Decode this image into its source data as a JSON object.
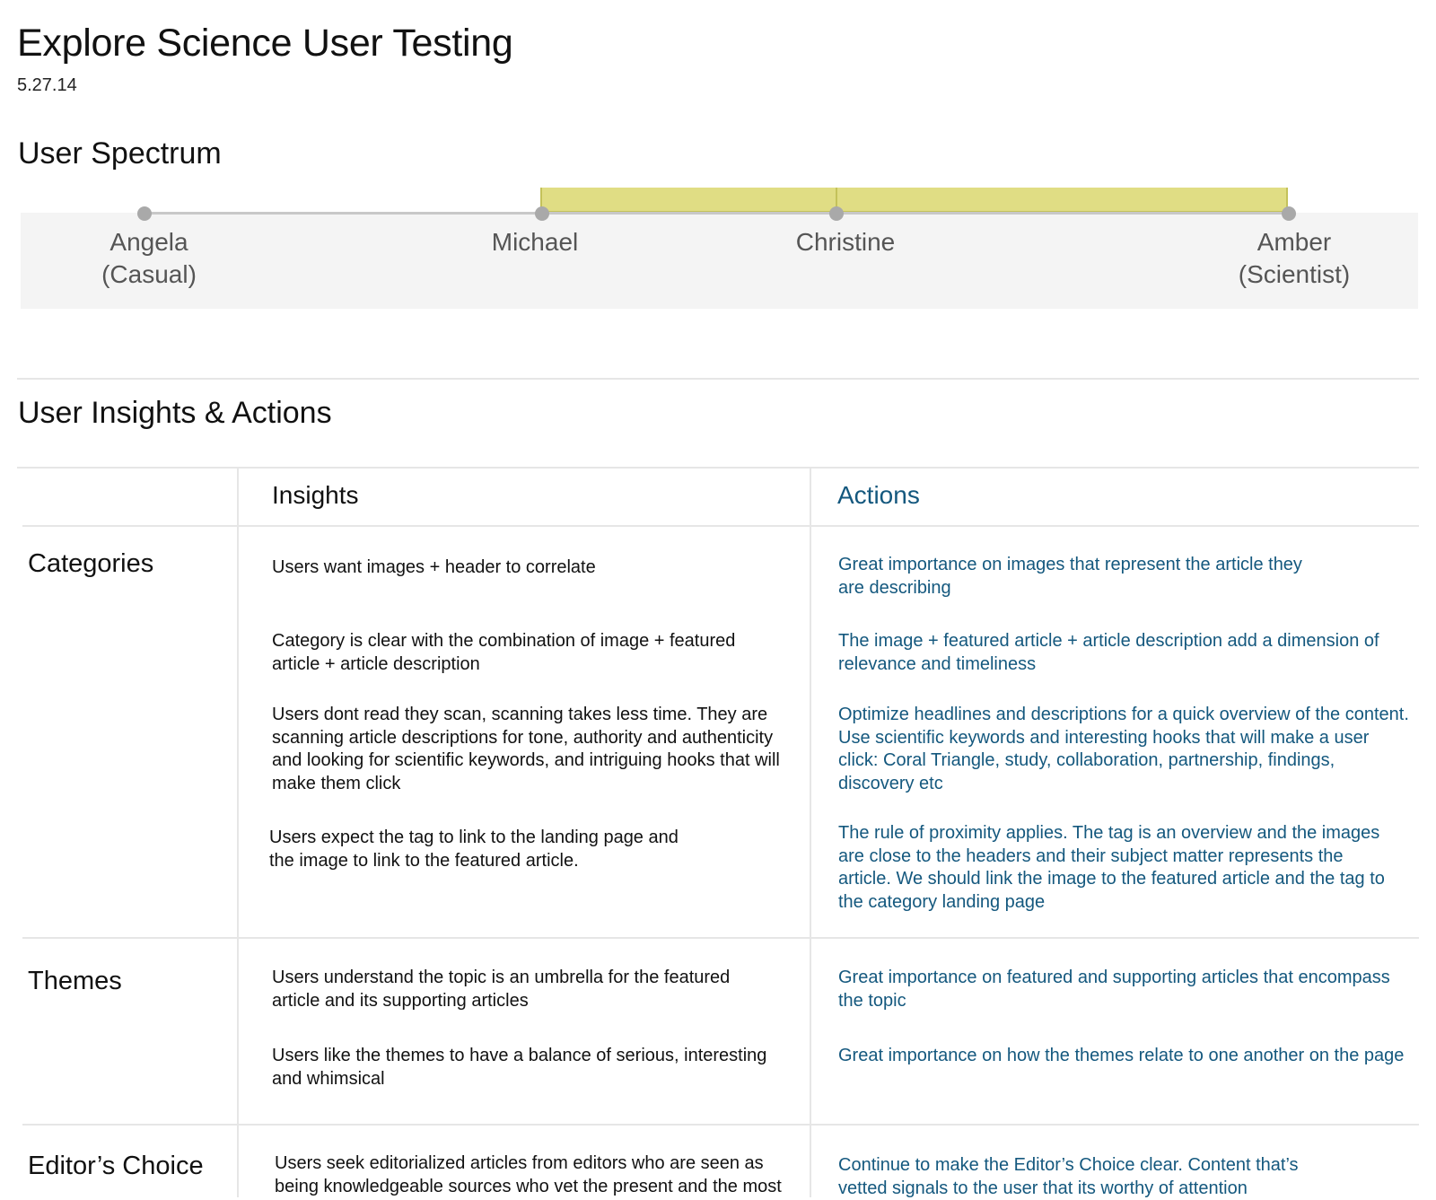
{
  "header": {
    "title": "Explore Science User Testing",
    "date": "5.27.14"
  },
  "spectrum": {
    "heading": "User Spectrum",
    "users": [
      {
        "name": "Angela",
        "type": "(Casual)"
      },
      {
        "name": "Michael",
        "type": ""
      },
      {
        "name": "Christine",
        "type": ""
      },
      {
        "name": "Amber",
        "type": "(Scientist)"
      }
    ],
    "colors": {
      "highlight": "#e0dd84",
      "dot": "#a9a9a9",
      "panel": "#f4f4f4"
    }
  },
  "insights_actions": {
    "heading": "User Insights & Actions",
    "columns": {
      "insights": "Insights",
      "actions": "Actions"
    },
    "action_color": "#14587e",
    "rows": [
      {
        "label": "Categories",
        "items": [
          {
            "insight": "Users want images + header to correlate",
            "action": "Great importance on images that represent the article they are describing"
          },
          {
            "insight": "Category is clear with the combination of image + featured article + article description",
            "action": "The image + featured article + article description add a dimension of relevance and timeliness"
          },
          {
            "insight": "Users dont read they scan, scanning takes less time. They are scanning article descriptions for tone, authority and authenticity and looking for scientific keywords, and intriguing hooks that will make them click",
            "action": "Optimize headlines and descriptions for a quick overview of the content. Use scientific keywords and interesting hooks that will make a user click: Coral Triangle, study, collaboration, partnership, findings, discovery etc"
          },
          {
            "insight": "Users expect the tag to link to the landing page and the image to link to the featured article.",
            "action": "The rule of proximity applies. The tag is an overview and the images are close to the headers and their subject matter represents the article. We should link the image to the featured article and the tag to the category landing page"
          }
        ]
      },
      {
        "label": "Themes",
        "items": [
          {
            "insight": "Users understand the topic is an umbrella for the featured article and its supporting articles",
            "action": "Great importance on featured and supporting articles that encompass the topic"
          },
          {
            "insight": "Users like the themes to have a balance of serious, interesting and whimsical",
            "action": "Great importance on how the themes relate to one another on the page"
          }
        ]
      },
      {
        "label": "Editor’s Choice",
        "items": [
          {
            "insight": "Users seek editorialized articles from editors who are seen as being knowledgeable sources who vet the present and the most",
            "action": "Continue to make the Editor’s Choice clear. Content that’s vetted signals to the user that its worthy of attention"
          }
        ]
      }
    ]
  }
}
